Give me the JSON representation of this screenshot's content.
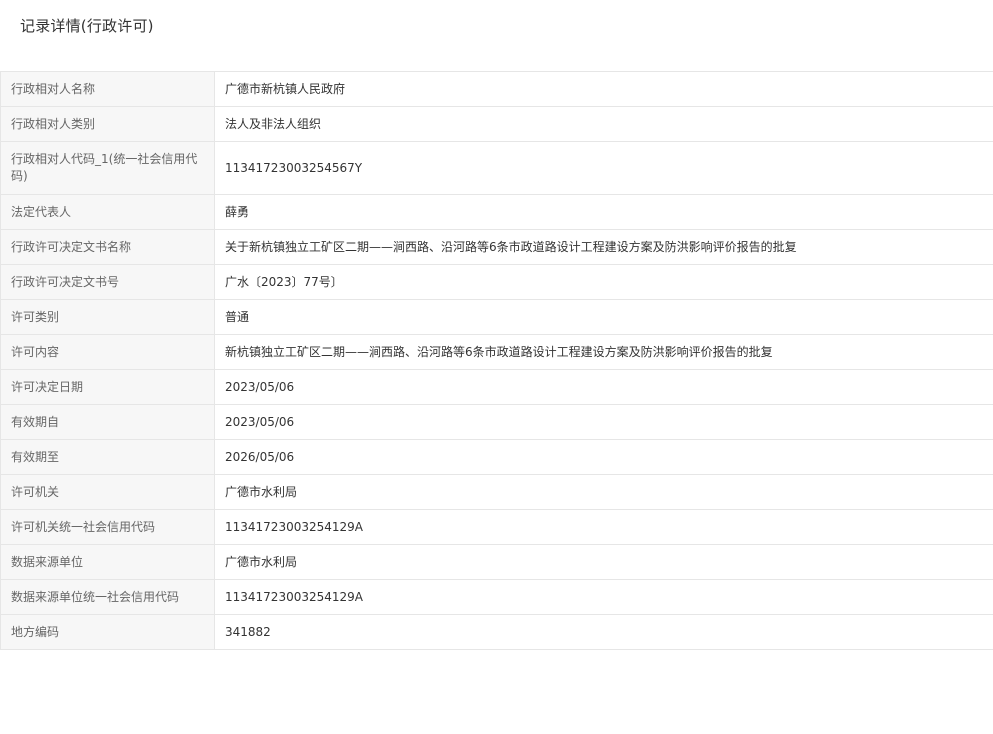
{
  "page_title": "记录详情(行政许可)",
  "rows": [
    {
      "label": "行政相对人名称",
      "value": "广德市新杭镇人民政府"
    },
    {
      "label": "行政相对人类别",
      "value": "法人及非法人组织"
    },
    {
      "label": "行政相对人代码_1(统一社会信用代码)",
      "value": "11341723003254567Y"
    },
    {
      "label": "法定代表人",
      "value": "薛勇"
    },
    {
      "label": "行政许可决定文书名称",
      "value": "关于新杭镇独立工矿区二期——涧西路、沿河路等6条市政道路设计工程建设方案及防洪影响评价报告的批复"
    },
    {
      "label": "行政许可决定文书号",
      "value": "广水〔2023〕77号〕"
    },
    {
      "label": "许可类别",
      "value": "普通"
    },
    {
      "label": "许可内容",
      "value": "新杭镇独立工矿区二期——涧西路、沿河路等6条市政道路设计工程建设方案及防洪影响评价报告的批复"
    },
    {
      "label": "许可决定日期",
      "value": "2023/05/06"
    },
    {
      "label": "有效期自",
      "value": "2023/05/06"
    },
    {
      "label": "有效期至",
      "value": "2026/05/06"
    },
    {
      "label": "许可机关",
      "value": "广德市水利局"
    },
    {
      "label": "许可机关统一社会信用代码",
      "value": "11341723003254129A"
    },
    {
      "label": "数据来源单位",
      "value": "广德市水利局"
    },
    {
      "label": "数据来源单位统一社会信用代码",
      "value": "11341723003254129A"
    },
    {
      "label": "地方编码",
      "value": "341882"
    }
  ]
}
